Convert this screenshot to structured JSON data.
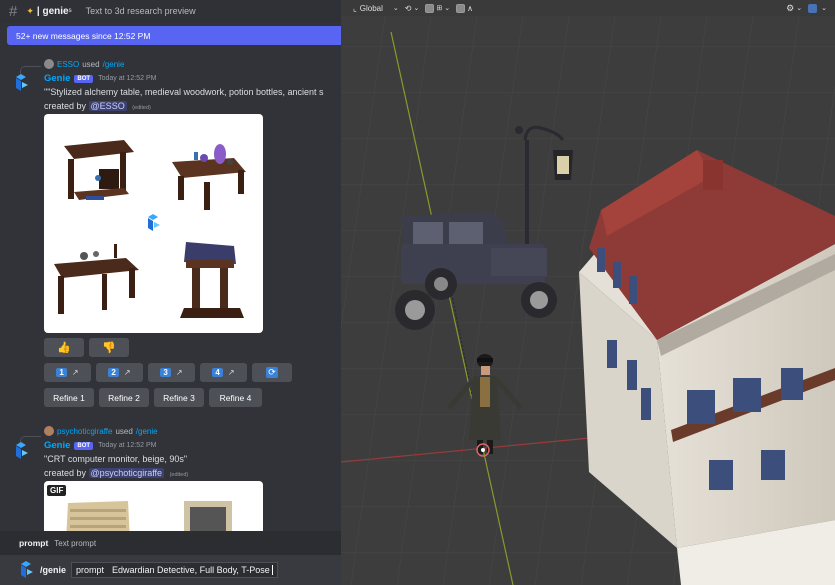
{
  "discord": {
    "channel": {
      "hash": "#",
      "icon": "sparkle-icon",
      "name": "| genie",
      "superscript": "s",
      "topic": "Text to 3d research preview"
    },
    "new_messages_banner": "52+ new messages since 12:52 PM",
    "messages": [
      {
        "reply_user": "ESSO",
        "reply_used": "used",
        "reply_command": "/genie",
        "author": "Genie",
        "bot_tag": "BOT",
        "timestamp": "Today at 12:52 PM",
        "prompt_text": "\"\"Stylized alchemy table, medieval woodwork, potion bottles, ancient s",
        "created_by": "created by",
        "creator": "@ESSO",
        "edited": "(edited)",
        "reactions": [
          "thumbs-up-icon",
          "thumbs-down-icon"
        ],
        "variant_buttons": [
          "1",
          "2",
          "3",
          "4"
        ],
        "refresh_icon": "refresh-icon",
        "refine_buttons": [
          "Refine 1",
          "Refine 2",
          "Refine 3",
          "Refine 4"
        ]
      },
      {
        "reply_user": "psychoticgiraffe",
        "reply_used": "used",
        "reply_command": "/genie",
        "author": "Genie",
        "bot_tag": "BOT",
        "timestamp": "Today at 12:52 PM",
        "prompt_text": "\"CRT computer monitor, beige, 90s\"",
        "created_by": "created by",
        "creator": "@psychoticgiraffe",
        "edited": "(edited)",
        "gif_badge": "GIF"
      }
    ],
    "command_popup": {
      "option_name": "prompt",
      "option_desc": "Text prompt"
    },
    "input": {
      "command": "/genie",
      "option": "prompt",
      "value": "Edwardian Detective, Full Body, T-Pose"
    }
  },
  "viewport": {
    "transform_orientation": "Global",
    "toolbar_icons": [
      "transform-icon",
      "chevron-down-icon",
      "link-icon",
      "snap-icon",
      "proportional-icon",
      "overlay-icon",
      "gizmo-icon"
    ]
  },
  "colors": {
    "discord_bg": "#313338",
    "blurple": "#5865f2",
    "link": "#00a8fc",
    "viewport_bg": "#3d3d3d",
    "roof_red": "#8e3a36"
  }
}
